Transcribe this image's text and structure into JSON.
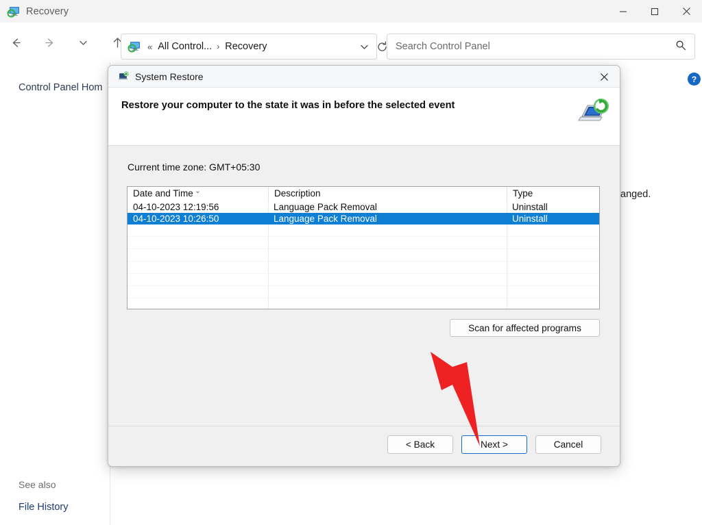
{
  "window": {
    "title": "Recovery",
    "title_icon": "recovery-icon",
    "controls": {
      "minimize": "minimize-icon",
      "maximize": "maximize-icon",
      "close": "close-icon"
    }
  },
  "nav": {
    "back": "back-arrow-icon",
    "forward": "forward-arrow-icon",
    "recent": "chevron-down-icon",
    "up": "up-arrow-icon",
    "refresh": "refresh-icon"
  },
  "address": {
    "icon": "recovery-icon",
    "overflow": "«",
    "crumbs": [
      "All Control...",
      "Recovery"
    ],
    "separator": "›",
    "dropdown": "chevron-down-icon"
  },
  "search": {
    "placeholder": "Search Control Panel",
    "icon": "search-icon"
  },
  "page": {
    "control_panel_home": "Control Panel Hom",
    "see_also": "See also",
    "file_history": "File History",
    "background_text_right": "anged.",
    "help": "?"
  },
  "dialog": {
    "title": "System Restore",
    "title_icon": "system-restore-icon",
    "close": "✕",
    "heading": "Restore your computer to the state it was in before the selected event",
    "header_icon": "system-restore-large-icon",
    "timezone_label": "Current time zone: GMT+05:30",
    "list": {
      "columns": [
        "Date and Time",
        "Description",
        "Type"
      ],
      "sort_indicator": "⌄",
      "rows": [
        {
          "date": "04-10-2023 12:19:56",
          "description": "Language Pack Removal",
          "type": "Uninstall",
          "selected": false
        },
        {
          "date": "04-10-2023 10:26:50",
          "description": "Language Pack Removal",
          "type": "Uninstall",
          "selected": true
        }
      ],
      "empty_row_count": 10
    },
    "scan_button": "Scan for affected programs",
    "buttons": {
      "back": "< Back",
      "next": "Next >",
      "cancel": "Cancel"
    }
  },
  "colors": {
    "selection_blue": "#0f7fd4",
    "focus_blue": "#1668c6",
    "annotation_red": "#ee2222",
    "link_blue": "#1c3b70"
  },
  "annotation": {
    "arrow": "red-arrow-pointing-to-next-button"
  }
}
